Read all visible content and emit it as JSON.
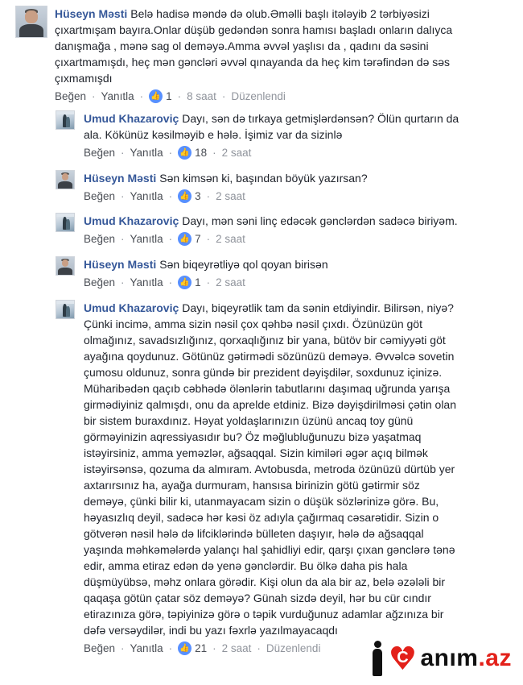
{
  "comments": [
    {
      "author": "Hüseyn Məsti",
      "lines": [
        "Belə hadisə məndə də olub.Əməlli başlı itələyib 2 tərbiyəsizi",
        "çıxartmışam bayıra.Onlar düşüb gedəndən sonra hamısı başladı onların dalıyca",
        "danışmağa , mənə sag ol deməyə.Amma əvvəl yaşlısı da , qadını da səsini",
        "çıxartmamışdı, heç mən gəncləri əvvəl qınayanda da heç kim tərəfindən də səs",
        "çıxmamışdı"
      ],
      "like_label": "Beğen",
      "reply_label": "Yanıtla",
      "likes": "1",
      "time": "8 saat",
      "edited": "Düzenlendi"
    },
    {
      "author": "Umud Khazaroviç",
      "lines": [
        "Dayı, sən də tırkaya getmişlərdənsən? Ölün qurtarın da",
        "ala. Kökünüz kəsilməyib e hələ. İşimiz var da sizinlə"
      ],
      "like_label": "Beğen",
      "reply_label": "Yanıtla",
      "likes": "18",
      "time": "2 saat"
    },
    {
      "author": "Hüseyn Məsti",
      "lines": [
        "Sən kimsən ki, başından böyük yazırsan?"
      ],
      "like_label": "Beğen",
      "reply_label": "Yanıtla",
      "likes": "3",
      "time": "2 saat"
    },
    {
      "author": "Umud Khazaroviç",
      "lines": [
        "Dayı, mən səni linç edəcək gənclərdən sadəcə biriyəm."
      ],
      "like_label": "Beğen",
      "reply_label": "Yanıtla",
      "likes": "7",
      "time": "2 saat"
    },
    {
      "author": "Hüseyn Məsti",
      "lines": [
        "Sən biqeyrətliyə qol qoyan birisən"
      ],
      "like_label": "Beğen",
      "reply_label": "Yanıtla",
      "likes": "1",
      "time": "2 saat"
    },
    {
      "author": "Umud Khazaroviç",
      "lines": [
        "Dayı, biqeyrətlik tam da sənin etdiyindir. Bilirsən, niyə?",
        "Çünki incimə, amma sizin nəsil çox qəhbə nəsil çıxdı. Özünüzün göt",
        "olmağınız, savadsızlığınız, qorxaqlığınız bir yana, bütöv bir cəmiyyəti göt",
        "ayağına qoydunuz. Götünüz gətirmədi sözünüzü deməyə. Əvvəlcə sovetin",
        "çumosu oldunuz, sonra gündə bir prezident dəyişdilər, soxdunuz içinizə.",
        "Müharibədən qaçıb cəbhədə ölənlərin tabutlarını daşımaq uğrunda yarışa",
        "girmədiyiniz qalmışdı, onu da aprelde etdiniz. Bizə dəyişdirilməsi çətin olan",
        "bir sistem buraxdınız. Həyat yoldaşlarınızın üzünü ancaq toy günü",
        "görməyinizin aqressiyasıdır bu? Öz məğlubluğunuzu bizə yaşatmaq",
        "istəyirsiniz, amma yeməzlər, ağsaqqal. Sizin kimiləri əgər açıq bilmək",
        "istəyirsənsə, qozuma da almıram. Avtobusda, metroda özünüzü dürtüb yer",
        "axtarırsınız ha, ayağa durmuram, hansısa birinizin götü gətirmir söz",
        "deməyə, çünki bilir ki, utanmayacam sizin o düşük sözlərinizə görə. Bu,",
        "həyasızlıq deyil, sadəcə hər kəsi öz adıyla çağırmaq cəsarətidir. Sizin o",
        "götverən nəsil hələ də lifciklərində bülleten daşıyır, hələ də ağsaqqal",
        "yaşında məhkəmələrdə yalançı hal şahidliyi edir, qarşı çıxan gənclərə tənə",
        "edir, amma etiraz edən də yenə gənclərdir. Bu ölkə daha pis hala",
        "düşmüyübsə, məhz onlara görədir. Kişi olun da ala bir az, belə əzələli bir",
        "qaqaşa götün çatar söz deməyə? Günah sizdə deyil, hər bu cür cındır",
        "etirazınıza görə, təpiyinizə görə o təpik vurduğunuz adamlar ağzınıza bir",
        "dəfə versəydilər, indi bu yazı fəxrlə yazılmayacaqdı"
      ],
      "like_label": "Beğen",
      "reply_label": "Yanıtla",
      "likes": "21",
      "time": "2 saat",
      "edited": "Düzenlendi"
    }
  ],
  "watermark": {
    "letter": "C",
    "text_a": "anım",
    "text_b": ".az"
  },
  "colors": {
    "author": "#365899",
    "like_badge": "#5890ff",
    "watermark_red": "#e3211a"
  },
  "icons": {
    "like": "thumbs-up-icon",
    "heart": "heart-icon"
  }
}
